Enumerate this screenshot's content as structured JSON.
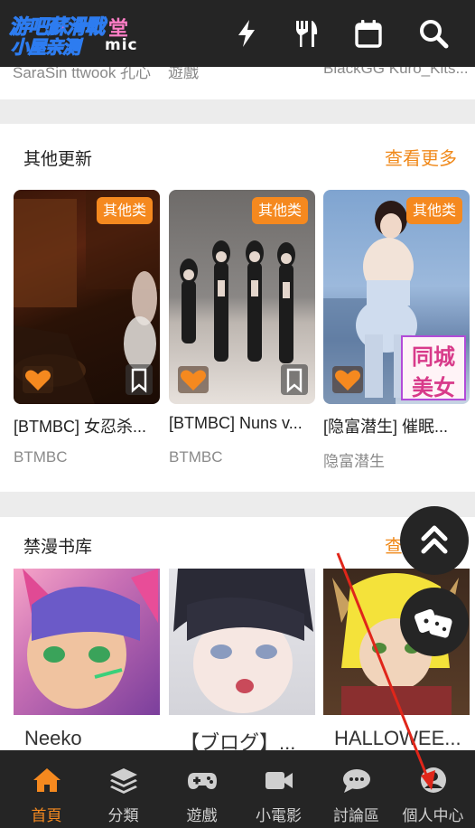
{
  "header": {
    "logo_line1": "游吧蘇滑戰",
    "logo_line2": "堂",
    "logo_line3": "小屋亲测",
    "logo_line4": "mic",
    "icons": [
      "lightning-icon",
      "utensils-icon",
      "calendar-icon",
      "search-icon"
    ]
  },
  "strip": {
    "left_text": "SaraSin ttwook 孔心",
    "mid_text": "遊戲",
    "right_text": "BlackGG Kuro_Kits..."
  },
  "section_other": {
    "title": "其他更新",
    "more": "查看更多",
    "cards": [
      {
        "badge": "其他类",
        "title": "[BTMBC] 女忍杀...",
        "author": "BTMBC"
      },
      {
        "badge": "其他类",
        "title": "[BTMBC] Nuns v...",
        "author": "BTMBC"
      },
      {
        "badge": "其他类",
        "title": "[隐富潜生] 催眠...",
        "author": "隐富潜生"
      }
    ],
    "ad_text_top": "同城",
    "ad_text_bottom": "美女"
  },
  "section_comics": {
    "title": "禁漫书库",
    "more": "查看更多",
    "cards": [
      {
        "title": "Neeko"
      },
      {
        "title": "【ブログ】..."
      },
      {
        "title": "HALLOWEE..."
      }
    ]
  },
  "bottom_nav": {
    "items": [
      {
        "label": "首頁",
        "icon": "home-icon",
        "active": true
      },
      {
        "label": "分類",
        "icon": "layers-icon",
        "active": false
      },
      {
        "label": "遊戲",
        "icon": "gamepad-icon",
        "active": false
      },
      {
        "label": "小電影",
        "icon": "video-icon",
        "active": false
      },
      {
        "label": "討論區",
        "icon": "chat-icon",
        "active": false
      },
      {
        "label": "個人中心",
        "icon": "user-icon",
        "active": false
      }
    ]
  },
  "colors": {
    "accent": "#f5891f",
    "header_bg": "#252525",
    "annotation_arrow": "#e0261a"
  }
}
